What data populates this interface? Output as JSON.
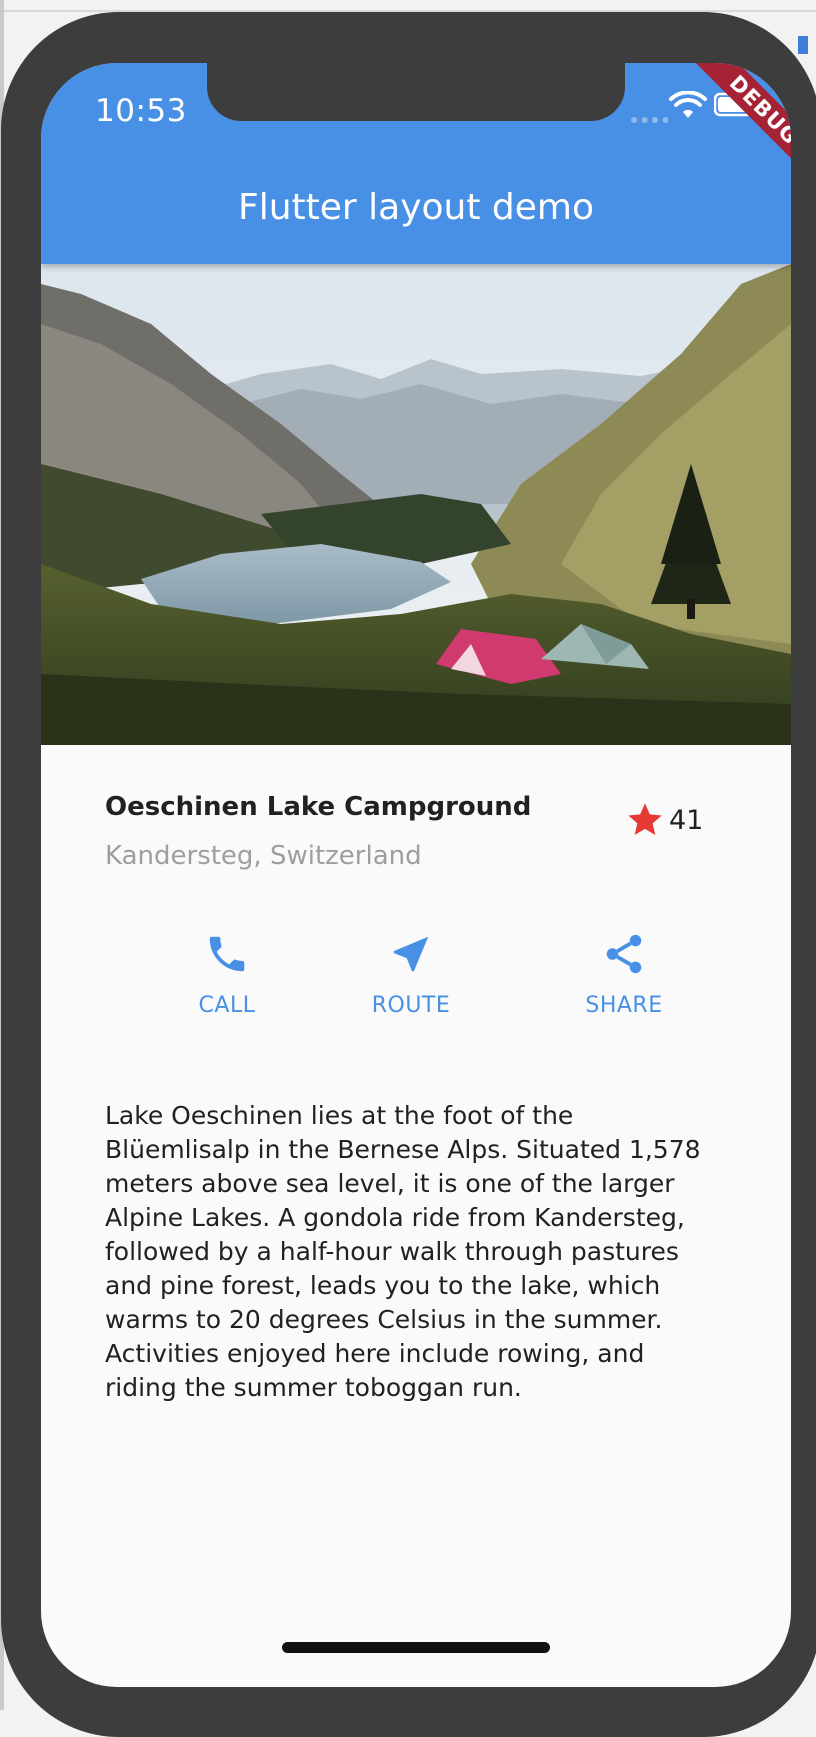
{
  "status_bar": {
    "time": "10:53",
    "debug_label": "DEBUG"
  },
  "app_bar": {
    "title": "Flutter layout demo",
    "color": "#4790e6"
  },
  "hero_image": {
    "subject": "lake-landscape-with-tents"
  },
  "title_section": {
    "name": "Oeschinen Lake Campground",
    "location": "Kandersteg, Switzerland",
    "rating_count": "41",
    "star_color": "#e53935"
  },
  "buttons": [
    {
      "label": "CALL",
      "icon": "phone-icon"
    },
    {
      "label": "ROUTE",
      "icon": "near-me-icon"
    },
    {
      "label": "SHARE",
      "icon": "share-icon"
    }
  ],
  "description": "Lake Oeschinen lies at the foot of the\nBlüemlisalp in the Bernese Alps. Situated 1,578\nmeters above sea level, it is one of the larger\nAlpine Lakes. A gondola ride from Kandersteg,\nfollowed by a half-hour walk through pastures\nand pine forest, leads you to the lake, which\nwarms to 20 degrees Celsius in the summer.\nActivities enjoyed here include rowing, and\nriding the summer toboggan run."
}
